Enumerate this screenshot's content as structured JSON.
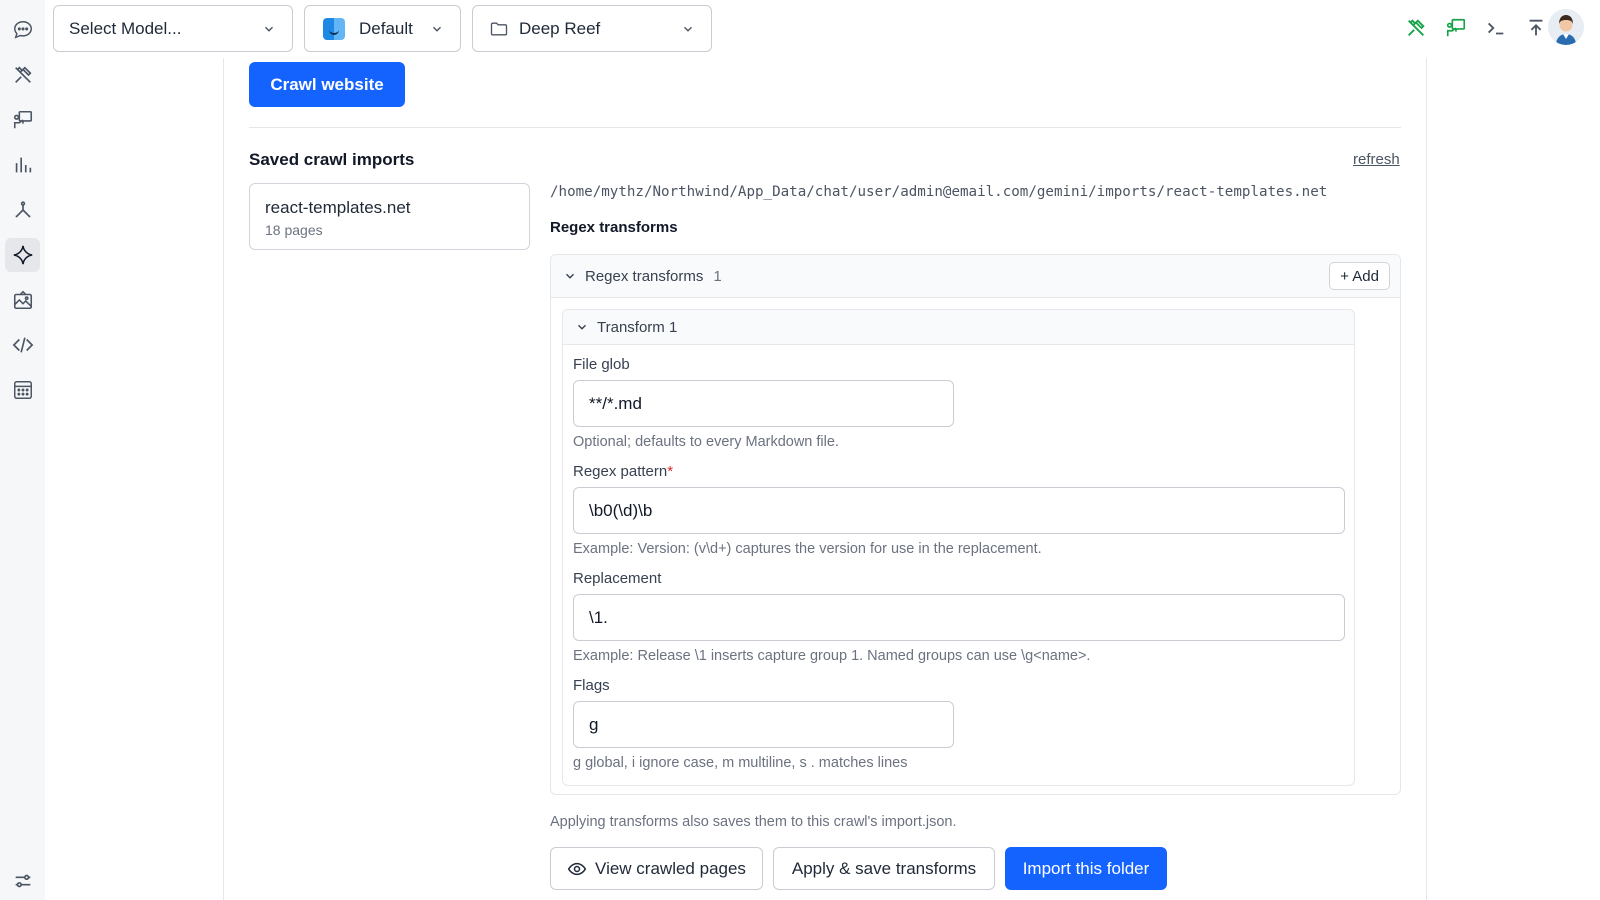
{
  "topbar": {
    "model_select": {
      "value": "Select Model...",
      "icon": "chevron-down-icon"
    },
    "profile_select": {
      "value": "Default",
      "icon": "finder-icon"
    },
    "folder_select": {
      "value": "Deep Reef",
      "icon": "folder-icon"
    },
    "right_icons": [
      "tools-icon",
      "chat-bubble-teacher-icon",
      "terminal-icon",
      "upload-icon",
      "user-avatar"
    ],
    "accent_color": "#16a34a"
  },
  "sidebar": {
    "items": [
      {
        "name": "chat",
        "icon": "chat-bubble-icon"
      },
      {
        "name": "tools",
        "icon": "tools-icon"
      },
      {
        "name": "presentations",
        "icon": "presenter-icon"
      },
      {
        "name": "analytics",
        "icon": "bar-chart-icon"
      },
      {
        "name": "nodes",
        "icon": "nodes-icon"
      },
      {
        "name": "gemini",
        "icon": "sparkle-icon",
        "active": true
      },
      {
        "name": "gallery",
        "icon": "image-icon"
      },
      {
        "name": "code",
        "icon": "code-icon"
      },
      {
        "name": "calculator",
        "icon": "calculator-icon"
      }
    ],
    "bottom_icon": "sliders-icon"
  },
  "main": {
    "crawl_button": "Crawl website",
    "saved_title": "Saved crawl imports",
    "refresh_label": "refresh",
    "imports": [
      {
        "name": "react-templates.net",
        "pages": "18 pages"
      }
    ],
    "selected_path": "/home/mythz/Northwind/App_Data/chat/user/admin@email.com/gemini/imports/react-templates.net",
    "regex_heading": "Regex transforms",
    "regex_panel": {
      "title": "Regex transforms",
      "count": "1",
      "add_label": "+ Add",
      "transforms": [
        {
          "title": "Transform 1",
          "file_glob_label": "File glob",
          "file_glob_value": "**/*.md",
          "file_glob_help": "Optional; defaults to every Markdown file.",
          "pattern_label": "Regex pattern",
          "pattern_required": "*",
          "pattern_value": "\\b0(\\d)\\b",
          "pattern_help": "Example: Version: (v\\d+) captures the version for use in the replacement.",
          "replacement_label": "Replacement",
          "replacement_value": "\\1.",
          "replacement_help": "Example: Release \\1 inserts capture group 1. Named groups can use \\g<name>.",
          "flags_label": "Flags",
          "flags_value": "g",
          "flags_help": "g global, i ignore case, m multiline, s . matches lines"
        }
      ]
    },
    "apply_note": "Applying transforms also saves them to this crawl's import.json.",
    "buttons": {
      "view": "View crawled pages",
      "apply": "Apply & save transforms",
      "import": "Import this folder"
    },
    "primary_color": "#1463ff"
  }
}
